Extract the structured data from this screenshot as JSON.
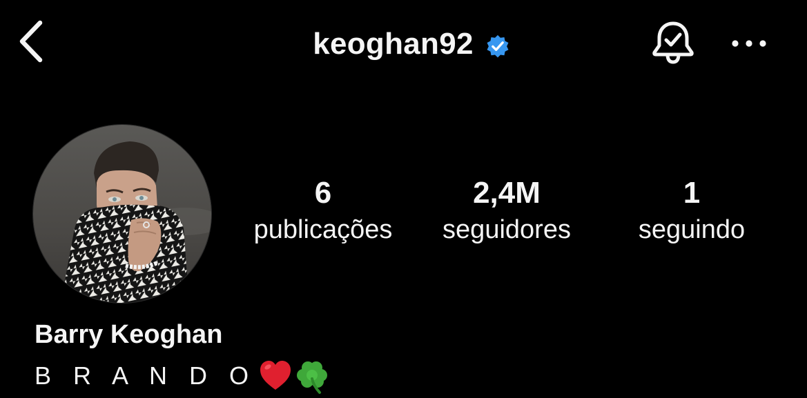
{
  "header": {
    "username": "keoghan92",
    "verified": true,
    "icons": {
      "back": "chevron-left-icon",
      "verified": "verified-badge-icon",
      "notifications": "bell-check-icon",
      "more": "more-horizontal-icon"
    }
  },
  "profile": {
    "avatar": "profile-photo",
    "stats": [
      {
        "count": "6",
        "label": "publicações"
      },
      {
        "count": "2,4M",
        "label": "seguidores"
      },
      {
        "count": "1",
        "label": "seguindo"
      }
    ],
    "display_name": "Barry Keoghan",
    "bio": {
      "text": "B R A N D O",
      "emojis": [
        "heart-emoji",
        "shamrock-emoji"
      ]
    }
  },
  "colors": {
    "background": "#000000",
    "text": "#f5f5f5",
    "verified_badge": "#3797f0",
    "heart": "#e0202f",
    "shamrock": "#3fa83a"
  }
}
